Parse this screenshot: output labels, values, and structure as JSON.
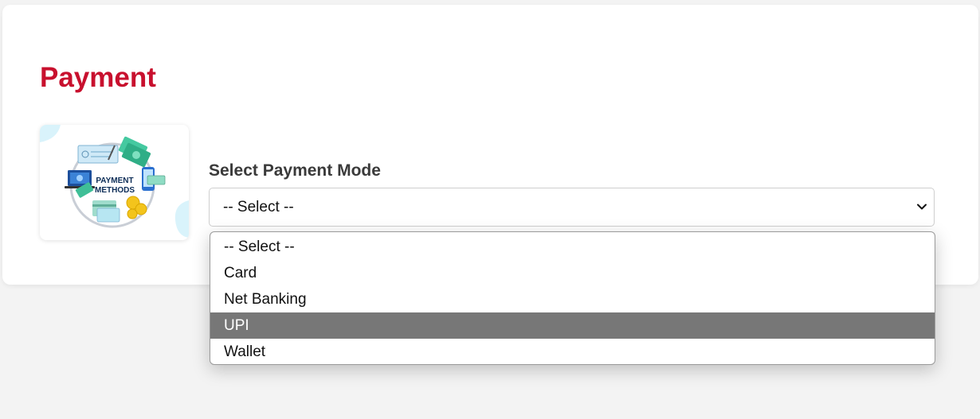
{
  "header": {
    "title": "Payment"
  },
  "illustration": {
    "text_line1": "PAYMENT",
    "text_line2": "METHODS"
  },
  "payment": {
    "label": "Select Payment Mode",
    "selected_value": "-- Select --",
    "options": [
      {
        "label": "-- Select --",
        "highlighted": false
      },
      {
        "label": "Card",
        "highlighted": false
      },
      {
        "label": "Net Banking",
        "highlighted": false
      },
      {
        "label": "UPI",
        "highlighted": true
      },
      {
        "label": "Wallet",
        "highlighted": false
      }
    ]
  },
  "colors": {
    "accent": "#c8102e",
    "highlight": "#777777"
  },
  "icons": {
    "select_arrow": "chevron-down-icon",
    "image": "payment-methods-illustration"
  }
}
